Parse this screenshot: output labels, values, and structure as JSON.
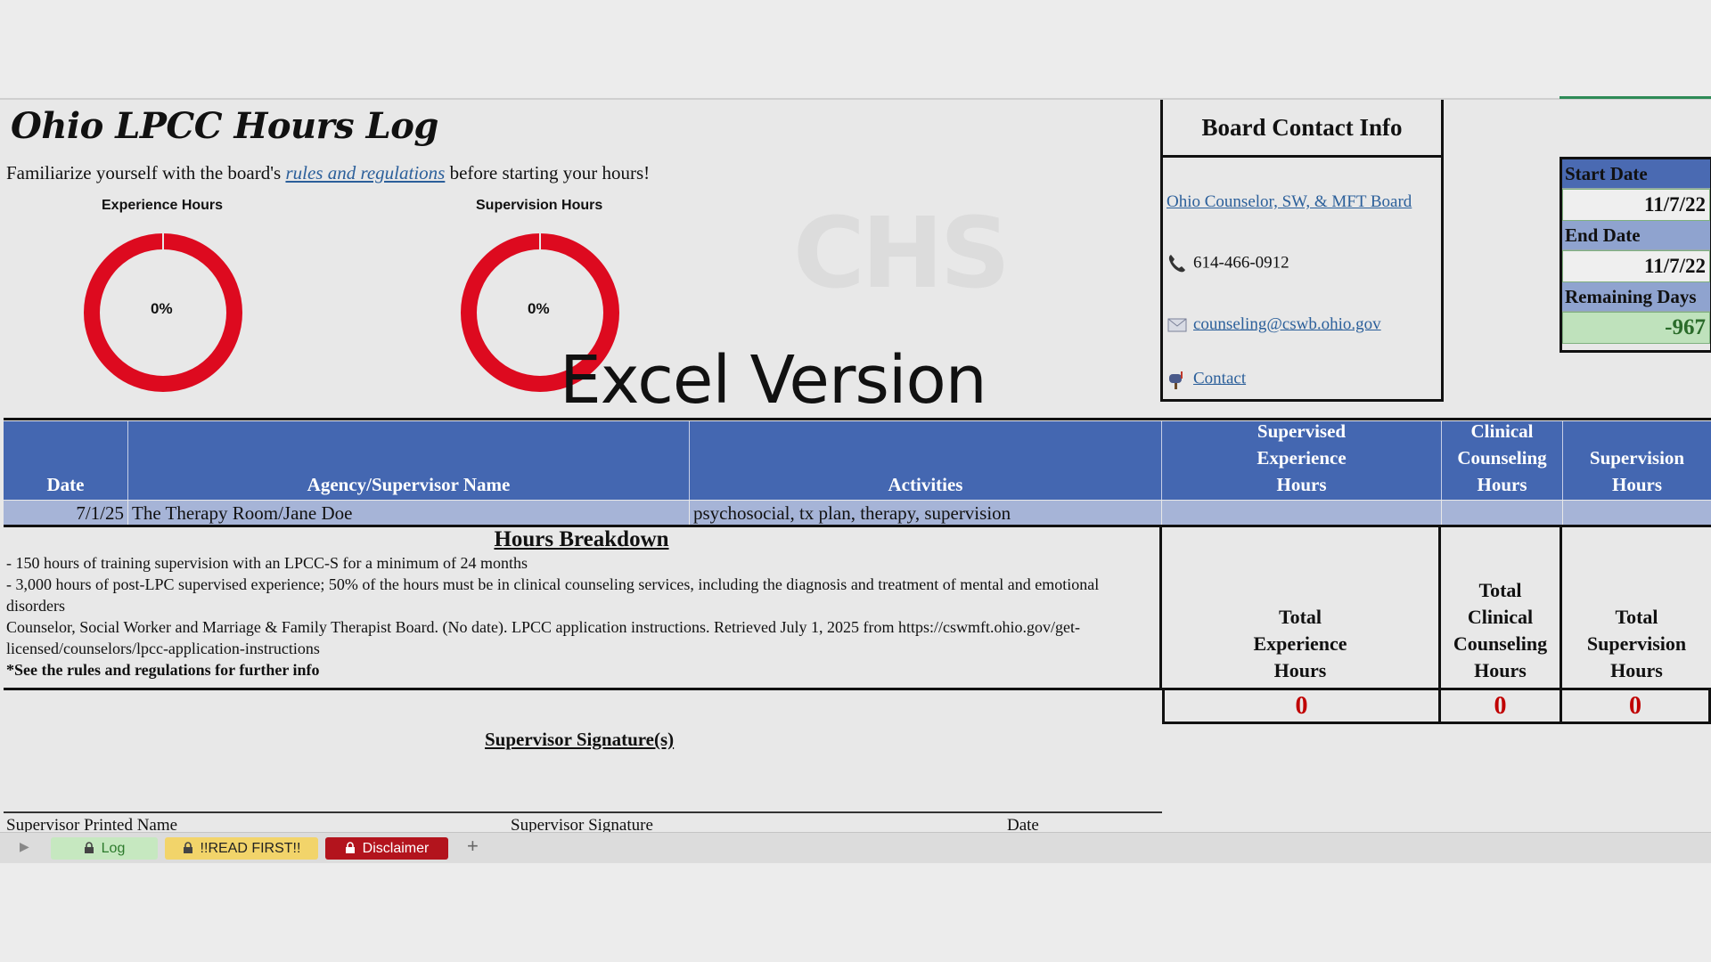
{
  "title": "Ohio LPCC Hours Log",
  "intro": {
    "before": "Familiarize yourself with the board's ",
    "link": "rules and regulations",
    "after": " before starting your hours!"
  },
  "charts": {
    "experience": {
      "label": "Experience Hours",
      "percent_text": "0%",
      "percent": 0,
      "color": "#dd0a1f"
    },
    "supervision": {
      "label": "Supervision Hours",
      "percent_text": "0%",
      "percent": 0,
      "color": "#dd0a1f"
    }
  },
  "watermark": "CHS",
  "overlay_text": "Excel Version",
  "board": {
    "heading": "Board Contact Info",
    "link": "Ohio Counselor, SW, & MFT Board",
    "phone": "614-466-0912",
    "email": "counseling@cswb.ohio.gov",
    "contact": "Contact"
  },
  "dates": {
    "start_label": "Start Date",
    "start_value": "11/7/22",
    "end_label": "End Date",
    "end_value": "11/7/22",
    "remaining_label": "Remaining Days",
    "remaining_value": "-967"
  },
  "table": {
    "headers": [
      "Date",
      "Agency/Supervisor Name",
      "Activities"
    ],
    "header_supervised": [
      "Supervised",
      "Experience",
      "Hours"
    ],
    "header_clinical": [
      "Clinical",
      "Counseling",
      "Hours"
    ],
    "header_supervision": [
      "Supervision",
      "Hours"
    ],
    "row": {
      "date": "7/1/25",
      "agency": "The Therapy Room/Jane Doe",
      "activities": "psychosocial, tx plan, therapy, supervision"
    }
  },
  "breakdown": {
    "title": "Hours Breakdown",
    "lines": [
      "- 150 hours of training supervision with an LPCC-S for a minimum of 24 months",
      "- 3,000 hours of post-LPC supervised experience; 50% of the hours must be in clinical counseling services, including the diagnosis and treatment of mental and emotional disorders",
      "Counselor, Social Worker and Marriage & Family Therapist Board. (No date). LPCC application instructions. Retrieved July 1, 2025 from https://cswmft.ohio.gov/get-licensed/counselors/lpcc-application-instructions"
    ],
    "note": "*See the rules and regulations for further info"
  },
  "totals": {
    "experience_label": [
      "Total",
      "Experience",
      "Hours"
    ],
    "clinical_label": [
      "Total",
      "Clinical",
      "Counseling",
      "Hours"
    ],
    "supervision_label": [
      "Total",
      "Supervision",
      "Hours"
    ],
    "experience_value": "0",
    "clinical_value": "0",
    "supervision_value": "0"
  },
  "signature": {
    "title": "Supervisor Signature(s)",
    "printed_name": "Supervisor Printed Name",
    "signature": "Supervisor Signature",
    "date": "Date"
  },
  "tabs": [
    {
      "label": "Log",
      "bg": "#c6e8c0",
      "color": "#2c7a2c"
    },
    {
      "label": "!!READ FIRST!!",
      "bg": "#f2d46a",
      "color": "#222"
    },
    {
      "label": "Disclaimer",
      "bg": "#b3141d",
      "color": "#ffffff"
    }
  ],
  "icons": {
    "phone": "phone-icon",
    "email": "envelope-icon",
    "contact": "mailbox-icon",
    "lock": "lock-icon",
    "next": "play-arrow-icon",
    "add": "plus-icon"
  }
}
